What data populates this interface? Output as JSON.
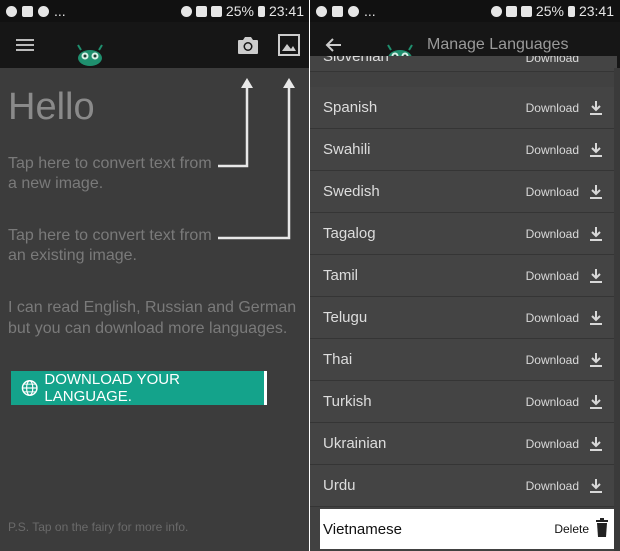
{
  "left_screen": {
    "status_bar": {
      "battery": "25%",
      "time": "23:41"
    },
    "app_bar": {
      "menu_icon": "menu-icon",
      "camera_icon": "camera-icon",
      "gallery_icon": "image-icon"
    },
    "greeting": "Hello",
    "tip_camera": "Tap here to convert text from a new image.",
    "tip_gallery": "Tap here to convert text from an existing image.",
    "languages_note": "I can read English, Russian and German but you can download more languages.",
    "download_button": {
      "label": "DOWNLOAD YOUR LANGUAGE.",
      "icon": "globe-icon",
      "color": "#14a38b"
    },
    "ps_note": "P.S. Tap on the fairy for more info."
  },
  "right_screen": {
    "status_bar": {
      "battery": "25%",
      "time": "23:41"
    },
    "app_bar": {
      "title": "Manage Languages",
      "back_icon": "back-arrow-icon"
    },
    "partial_top_language": "Slovenian",
    "partial_top_action": "Download",
    "languages": [
      {
        "name": "Spanish",
        "action": "Download"
      },
      {
        "name": "Swahili",
        "action": "Download"
      },
      {
        "name": "Swedish",
        "action": "Download"
      },
      {
        "name": "Tagalog",
        "action": "Download"
      },
      {
        "name": "Tamil",
        "action": "Download"
      },
      {
        "name": "Telugu",
        "action": "Download"
      },
      {
        "name": "Thai",
        "action": "Download"
      },
      {
        "name": "Turkish",
        "action": "Download"
      },
      {
        "name": "Ukrainian",
        "action": "Download"
      },
      {
        "name": "Urdu",
        "action": "Download"
      }
    ],
    "installed_language": {
      "name": "Vietnamese",
      "action": "Delete",
      "icon": "trash-icon"
    }
  }
}
